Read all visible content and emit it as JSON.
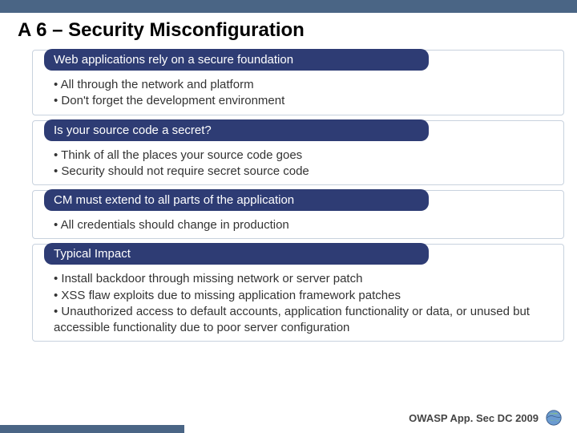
{
  "title": "A 6 – Security Misconfiguration",
  "sections": [
    {
      "heading": "Web applications rely on a secure foundation",
      "bullets": [
        "All through the network and platform",
        "Don't forget the development environment"
      ]
    },
    {
      "heading": "Is your source code a secret?",
      "bullets": [
        "Think of all the places your source code goes",
        "Security should not require secret source code"
      ]
    },
    {
      "heading": "CM must extend to all parts of the application",
      "bullets": [
        "All credentials should change in production"
      ]
    },
    {
      "heading": "Typical Impact",
      "bullets": [
        "Install backdoor through missing network or server patch",
        "XSS flaw exploits due to missing application framework patches",
        "Unauthorized access to default accounts, application functionality or data, or unused but accessible functionality due to poor server configuration"
      ]
    }
  ],
  "footer": "OWASP App. Sec DC 2009"
}
